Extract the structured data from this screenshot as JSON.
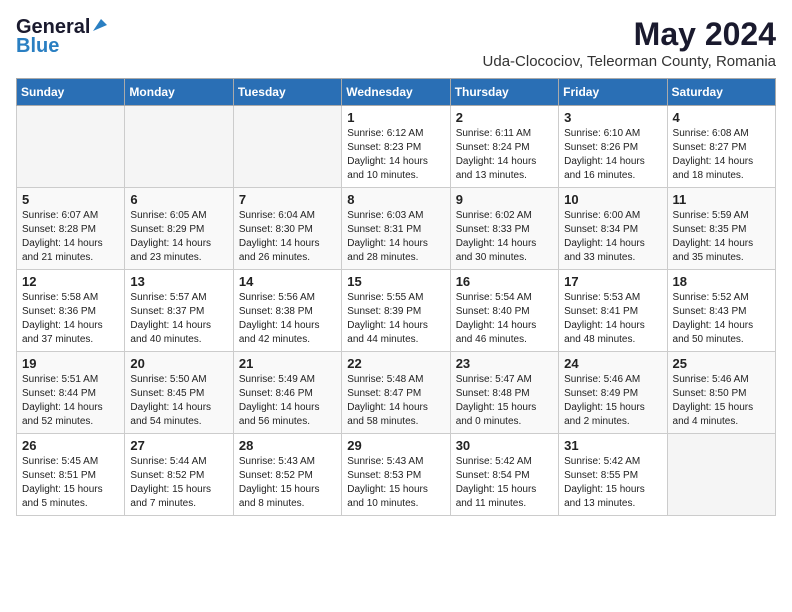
{
  "logo": {
    "general": "General",
    "blue": "Blue"
  },
  "header": {
    "month_year": "May 2024",
    "location": "Uda-Clocociov, Teleorman County, Romania"
  },
  "days_of_week": [
    "Sunday",
    "Monday",
    "Tuesday",
    "Wednesday",
    "Thursday",
    "Friday",
    "Saturday"
  ],
  "weeks": [
    [
      {
        "day": "",
        "info": ""
      },
      {
        "day": "",
        "info": ""
      },
      {
        "day": "",
        "info": ""
      },
      {
        "day": "1",
        "info": "Sunrise: 6:12 AM\nSunset: 8:23 PM\nDaylight: 14 hours\nand 10 minutes."
      },
      {
        "day": "2",
        "info": "Sunrise: 6:11 AM\nSunset: 8:24 PM\nDaylight: 14 hours\nand 13 minutes."
      },
      {
        "day": "3",
        "info": "Sunrise: 6:10 AM\nSunset: 8:26 PM\nDaylight: 14 hours\nand 16 minutes."
      },
      {
        "day": "4",
        "info": "Sunrise: 6:08 AM\nSunset: 8:27 PM\nDaylight: 14 hours\nand 18 minutes."
      }
    ],
    [
      {
        "day": "5",
        "info": "Sunrise: 6:07 AM\nSunset: 8:28 PM\nDaylight: 14 hours\nand 21 minutes."
      },
      {
        "day": "6",
        "info": "Sunrise: 6:05 AM\nSunset: 8:29 PM\nDaylight: 14 hours\nand 23 minutes."
      },
      {
        "day": "7",
        "info": "Sunrise: 6:04 AM\nSunset: 8:30 PM\nDaylight: 14 hours\nand 26 minutes."
      },
      {
        "day": "8",
        "info": "Sunrise: 6:03 AM\nSunset: 8:31 PM\nDaylight: 14 hours\nand 28 minutes."
      },
      {
        "day": "9",
        "info": "Sunrise: 6:02 AM\nSunset: 8:33 PM\nDaylight: 14 hours\nand 30 minutes."
      },
      {
        "day": "10",
        "info": "Sunrise: 6:00 AM\nSunset: 8:34 PM\nDaylight: 14 hours\nand 33 minutes."
      },
      {
        "day": "11",
        "info": "Sunrise: 5:59 AM\nSunset: 8:35 PM\nDaylight: 14 hours\nand 35 minutes."
      }
    ],
    [
      {
        "day": "12",
        "info": "Sunrise: 5:58 AM\nSunset: 8:36 PM\nDaylight: 14 hours\nand 37 minutes."
      },
      {
        "day": "13",
        "info": "Sunrise: 5:57 AM\nSunset: 8:37 PM\nDaylight: 14 hours\nand 40 minutes."
      },
      {
        "day": "14",
        "info": "Sunrise: 5:56 AM\nSunset: 8:38 PM\nDaylight: 14 hours\nand 42 minutes."
      },
      {
        "day": "15",
        "info": "Sunrise: 5:55 AM\nSunset: 8:39 PM\nDaylight: 14 hours\nand 44 minutes."
      },
      {
        "day": "16",
        "info": "Sunrise: 5:54 AM\nSunset: 8:40 PM\nDaylight: 14 hours\nand 46 minutes."
      },
      {
        "day": "17",
        "info": "Sunrise: 5:53 AM\nSunset: 8:41 PM\nDaylight: 14 hours\nand 48 minutes."
      },
      {
        "day": "18",
        "info": "Sunrise: 5:52 AM\nSunset: 8:43 PM\nDaylight: 14 hours\nand 50 minutes."
      }
    ],
    [
      {
        "day": "19",
        "info": "Sunrise: 5:51 AM\nSunset: 8:44 PM\nDaylight: 14 hours\nand 52 minutes."
      },
      {
        "day": "20",
        "info": "Sunrise: 5:50 AM\nSunset: 8:45 PM\nDaylight: 14 hours\nand 54 minutes."
      },
      {
        "day": "21",
        "info": "Sunrise: 5:49 AM\nSunset: 8:46 PM\nDaylight: 14 hours\nand 56 minutes."
      },
      {
        "day": "22",
        "info": "Sunrise: 5:48 AM\nSunset: 8:47 PM\nDaylight: 14 hours\nand 58 minutes."
      },
      {
        "day": "23",
        "info": "Sunrise: 5:47 AM\nSunset: 8:48 PM\nDaylight: 15 hours\nand 0 minutes."
      },
      {
        "day": "24",
        "info": "Sunrise: 5:46 AM\nSunset: 8:49 PM\nDaylight: 15 hours\nand 2 minutes."
      },
      {
        "day": "25",
        "info": "Sunrise: 5:46 AM\nSunset: 8:50 PM\nDaylight: 15 hours\nand 4 minutes."
      }
    ],
    [
      {
        "day": "26",
        "info": "Sunrise: 5:45 AM\nSunset: 8:51 PM\nDaylight: 15 hours\nand 5 minutes."
      },
      {
        "day": "27",
        "info": "Sunrise: 5:44 AM\nSunset: 8:52 PM\nDaylight: 15 hours\nand 7 minutes."
      },
      {
        "day": "28",
        "info": "Sunrise: 5:43 AM\nSunset: 8:52 PM\nDaylight: 15 hours\nand 8 minutes."
      },
      {
        "day": "29",
        "info": "Sunrise: 5:43 AM\nSunset: 8:53 PM\nDaylight: 15 hours\nand 10 minutes."
      },
      {
        "day": "30",
        "info": "Sunrise: 5:42 AM\nSunset: 8:54 PM\nDaylight: 15 hours\nand 11 minutes."
      },
      {
        "day": "31",
        "info": "Sunrise: 5:42 AM\nSunset: 8:55 PM\nDaylight: 15 hours\nand 13 minutes."
      },
      {
        "day": "",
        "info": ""
      }
    ]
  ]
}
